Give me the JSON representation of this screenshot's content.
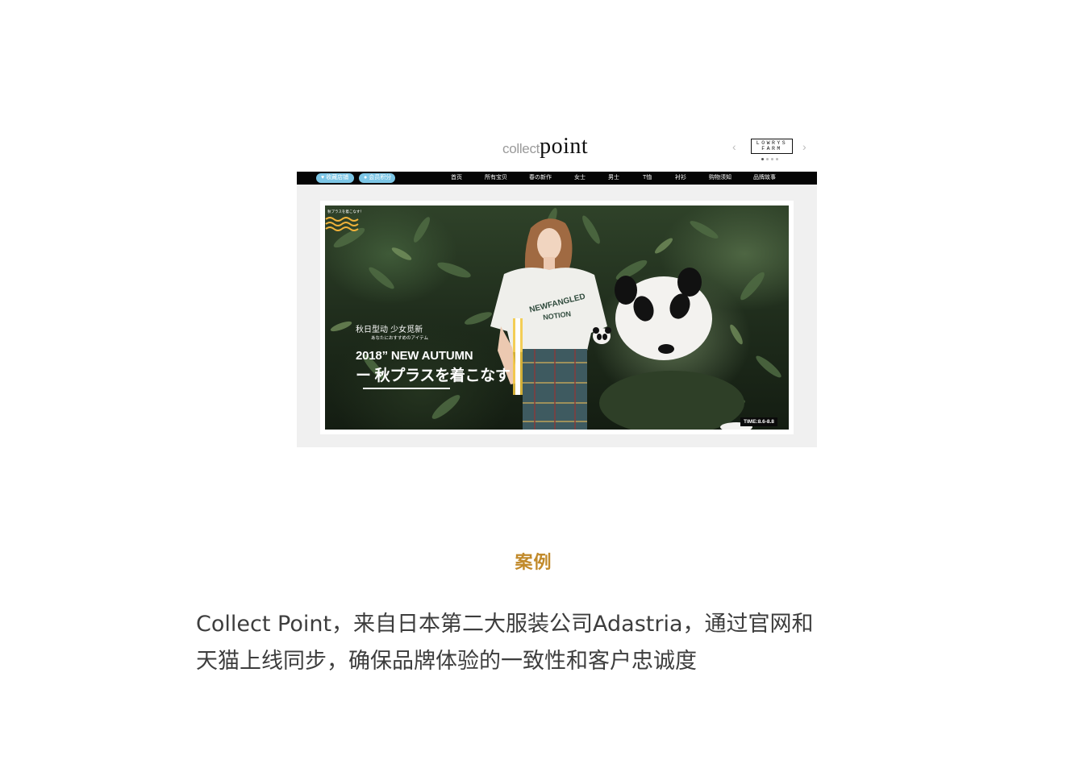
{
  "store": {
    "logo_part1": "collect",
    "logo_part2": "point",
    "brand_logo_line1": "LOWRYS",
    "brand_logo_line2": "FARM",
    "prev_arrow": "‹",
    "next_arrow": "›",
    "pill_fav_icon": "heart-icon",
    "pill_fav_label": "收藏店铺",
    "pill_member_icon": "user-icon",
    "pill_member_label": "会员积分",
    "nav_items": [
      "首页",
      "所有宝贝",
      "春の新作",
      "女士",
      "男士",
      "T恤",
      "衬衫",
      "购物须知",
      "品牌故事"
    ],
    "accent_color": "#7cc6e6"
  },
  "banner": {
    "tag_small": "秋プラスを着こなす！",
    "cn_line": "秋日型动  少女觅新",
    "jp_line": "あなたにおすすめのアイテム",
    "headline1": "2018”  NEW AUTUMN",
    "headline2": "ー 秋プラスを着こなす",
    "shirt_text": "NEWFANGLED NOTION",
    "time_badge": "TIME:8.6-8.8"
  },
  "caption": {
    "case_label": "案例",
    "case_color": "#c18a2b",
    "line1": "Collect Point，来自日本第二大服装公司Adastria，通过官网和",
    "line2": "天猫上线同步，确保品牌体验的一致性和客户忠诚度"
  }
}
